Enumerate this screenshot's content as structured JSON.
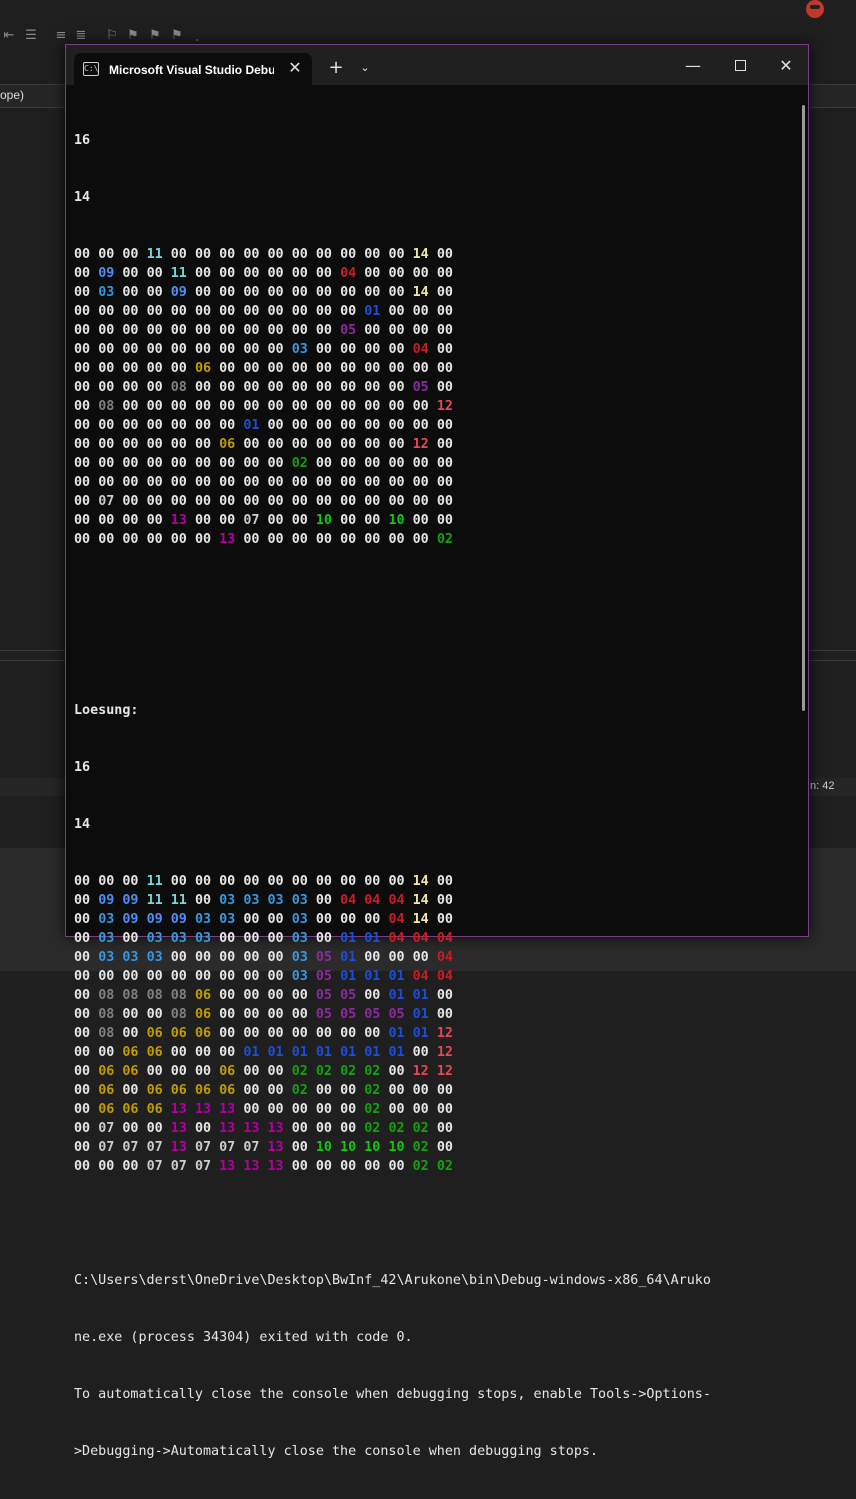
{
  "window": {
    "tab_title": "Microsoft Visual Studio Debug Console",
    "tab_icon_text": "C:\\",
    "new_tab_symbol": "+",
    "dropdown_symbol": "⌄",
    "minimize_symbol": "—",
    "close_symbol": "✕"
  },
  "ide": {
    "scope_text": "ope)",
    "status_text": "n: 42"
  },
  "colors": {
    "00": "#e6e6e6",
    "11": "#7ad6d6",
    "14": "#f4e7a0",
    "09": "#4f8ef7",
    "04": "#c81d25",
    "03": "#3a96dd",
    "01": "#1e4ed8",
    "05": "#8a2ba0",
    "06": "#c19c00",
    "08": "#808080",
    "12": "#e74856",
    "02": "#13a10e",
    "07": "#cccccc",
    "13": "#b4009e",
    "10": "#16c60c"
  },
  "console": {
    "header": [
      "16",
      "14"
    ],
    "grid1": [
      "00 00 00 11 00 00 00 00 00 00 00 00 00 00 14 00",
      "00 09 00 00 11 00 00 00 00 00 00 04 00 00 00 00",
      "00 03 00 00 09 00 00 00 00 00 00 00 00 00 14 00",
      "00 00 00 00 00 00 00 00 00 00 00 00 01 00 00 00",
      "00 00 00 00 00 00 00 00 00 00 00 05 00 00 00 00",
      "00 00 00 00 00 00 00 00 00 03 00 00 00 00 04 00",
      "00 00 00 00 00 06 00 00 00 00 00 00 00 00 00 00",
      "00 00 00 00 08 00 00 00 00 00 00 00 00 00 05 00",
      "00 08 00 00 00 00 00 00 00 00 00 00 00 00 00 12",
      "00 00 00 00 00 00 00 01 00 00 00 00 00 00 00 00",
      "00 00 00 00 00 00 06 00 00 00 00 00 00 00 12 00",
      "00 00 00 00 00 00 00 00 00 02 00 00 00 00 00 00",
      "00 00 00 00 00 00 00 00 00 00 00 00 00 00 00 00",
      "00 07 00 00 00 00 00 00 00 00 00 00 00 00 00 00",
      "00 00 00 00 13 00 00 07 00 00 10 00 00 10 00 00",
      "00 00 00 00 00 00 13 00 00 00 00 00 00 00 00 02"
    ],
    "solution_label": "Loesung:",
    "header2": [
      "16",
      "14"
    ],
    "grid2": [
      "00 00 00 11 00 00 00 00 00 00 00 00 00 00 14 00",
      "00 09 09 11 11 00 03 03 03 03 00 04 04 04 14 00",
      "00 03 09 09 09 03 03 00 00 03 00 00 00 04 14 00",
      "00 03 00 03 03 03 00 00 00 03 00 01 01 04 04 04",
      "00 03 03 03 00 00 00 00 00 03 05 01 00 00 00 04",
      "00 00 00 00 00 00 00 00 00 03 05 01 01 01 04 04",
      "00 08 08 08 08 06 00 00 00 00 05 05 00 01 01 00",
      "00 08 00 00 08 06 00 00 00 00 05 05 05 05 01 00",
      "00 08 00 06 06 06 00 00 00 00 00 00 00 01 01 12",
      "00 00 06 06 00 00 00 01 01 01 01 01 01 01 00 12",
      "00 06 06 00 00 00 06 00 00 02 02 02 02 00 12 12",
      "00 06 00 06 06 06 06 00 00 02 00 00 02 00 00 00",
      "00 06 06 06 13 13 13 00 00 00 00 00 02 00 00 00",
      "00 07 00 00 13 00 13 13 13 00 00 00 02 02 02 00",
      "00 07 07 07 13 07 07 07 13 00 10 10 10 10 02 00",
      "00 00 00 07 07 07 13 13 13 00 00 00 00 00 02 02"
    ],
    "exit_line1": "C:\\Users\\derst\\OneDrive\\Desktop\\BwInf_42\\Arukone\\bin\\Debug-windows-x86_64\\Aruko",
    "exit_line2": "ne.exe (process 34304) exited with code 0.",
    "info_line1": "To automatically close the console when debugging stops, enable Tools->Options-",
    "info_line2": ">Debugging->Automatically close the console when debugging stops."
  }
}
